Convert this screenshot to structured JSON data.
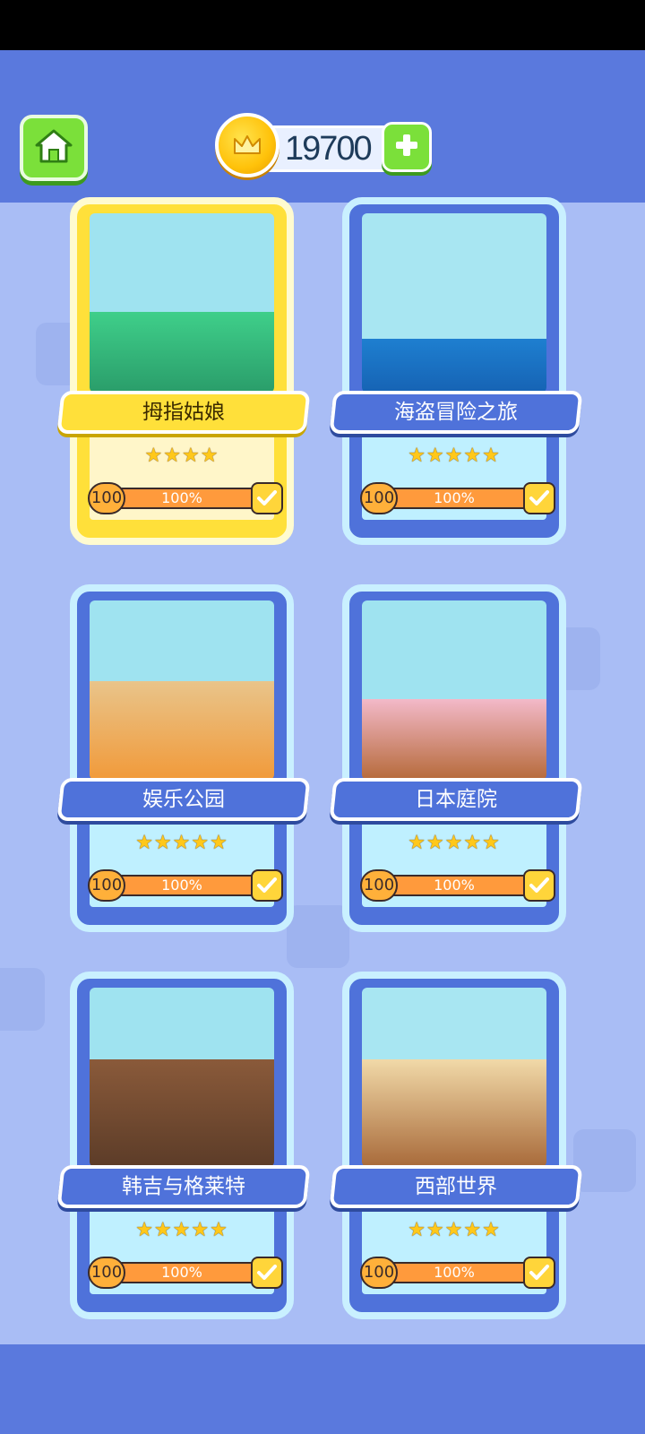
{
  "header": {
    "coins": "19700"
  },
  "icons": {
    "home": "home-icon",
    "coin": "crown-coin-icon",
    "plus": "plus-icon",
    "check": "check-icon",
    "star": "star-icon"
  },
  "colors": {
    "header_bg": "#5a79dd",
    "page_bg": "#a9bdf5",
    "card_blue": "#4f72da",
    "card_selected": "#ffe03a",
    "progress_fill": "#ff9a3c"
  },
  "levels": [
    {
      "title": "拇指姑娘",
      "stars": "★★★★",
      "star_count": 4,
      "level": "100",
      "progress": "100%",
      "progress_value": 1.0,
      "completed": true,
      "selected": true
    },
    {
      "title": "海盗冒险之旅",
      "stars": "★★★★★",
      "star_count": 5,
      "level": "100",
      "progress": "100%",
      "progress_value": 1.0,
      "completed": true,
      "selected": false
    },
    {
      "title": "娱乐公园",
      "stars": "★★★★★",
      "star_count": 5,
      "level": "100",
      "progress": "100%",
      "progress_value": 1.0,
      "completed": true,
      "selected": false
    },
    {
      "title": "日本庭院",
      "stars": "★★★★★",
      "star_count": 5,
      "level": "100",
      "progress": "100%",
      "progress_value": 1.0,
      "completed": true,
      "selected": false
    },
    {
      "title": "韩吉与格莱特",
      "stars": "★★★★★",
      "star_count": 5,
      "level": "100",
      "progress": "100%",
      "progress_value": 1.0,
      "completed": true,
      "selected": false
    },
    {
      "title": "西部世界",
      "stars": "★★★★★",
      "star_count": 5,
      "level": "100",
      "progress": "100%",
      "progress_value": 1.0,
      "completed": true,
      "selected": false
    }
  ]
}
